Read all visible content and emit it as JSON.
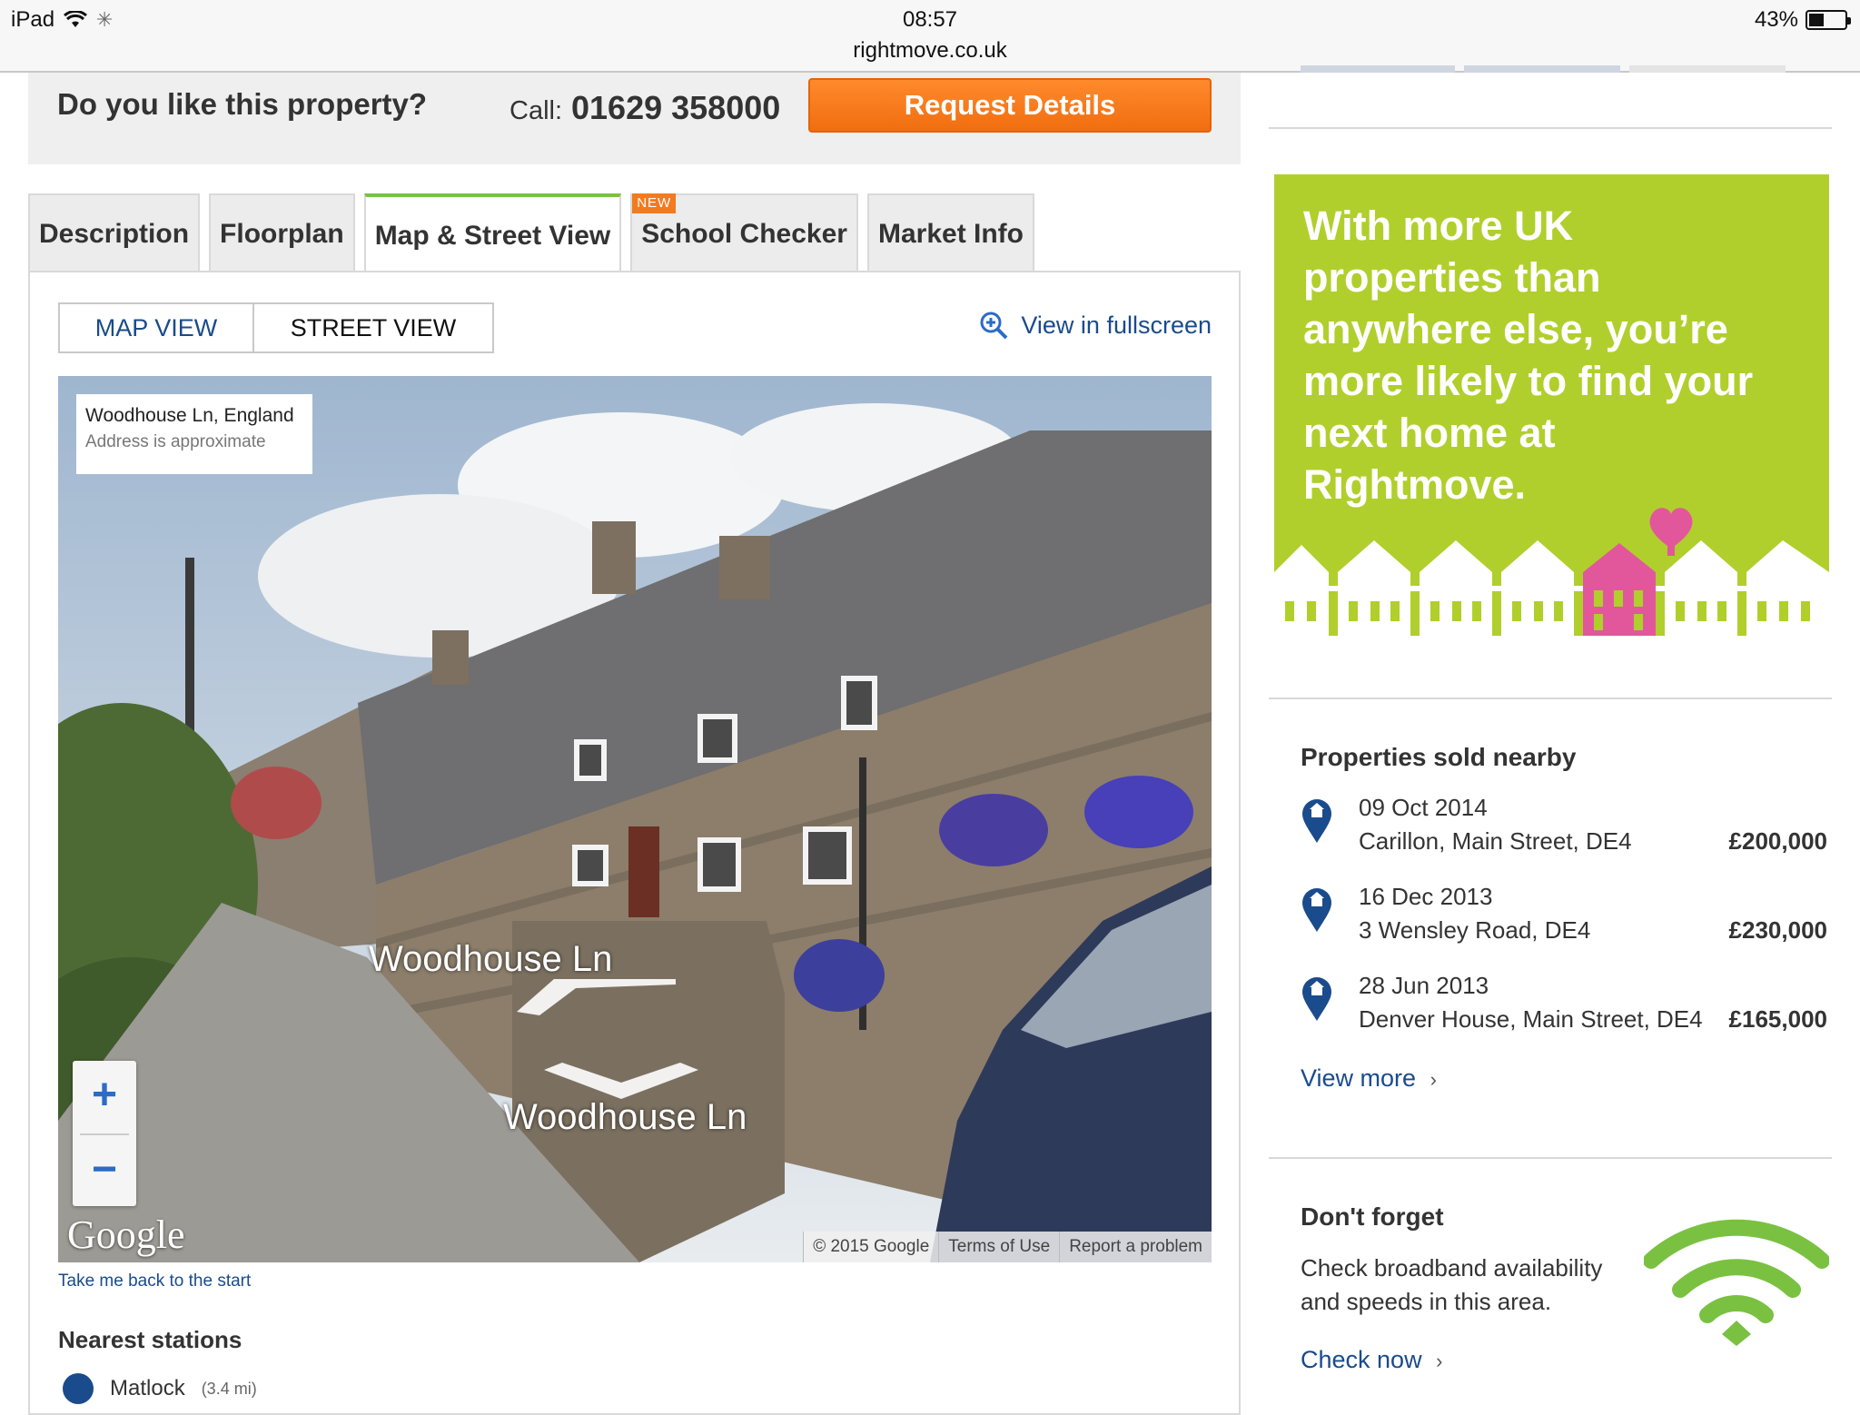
{
  "status_bar": {
    "device": "iPad",
    "time": "08:57",
    "url": "rightmove.co.uk",
    "battery": "43%",
    "battery_level": 0.43
  },
  "cta": {
    "question": "Do you like this property?",
    "call_label": "Call:",
    "phone": "01629 358000",
    "request_button": "Request Details"
  },
  "tabs": [
    {
      "label": "Description"
    },
    {
      "label": "Floorplan"
    },
    {
      "label": "Map & Street View",
      "active": true
    },
    {
      "label": "School Checker",
      "badge": "NEW"
    },
    {
      "label": "Market Info"
    }
  ],
  "map": {
    "map_view": "MAP VIEW",
    "street_view": "STREET VIEW",
    "fullscreen": "View in fullscreen",
    "address_line": "Woodhouse Ln, England",
    "address_note": "Address is approximate",
    "road_label_1": "Woodhouse Ln",
    "road_label_2": "Woodhouse Ln",
    "zoom_in": "+",
    "zoom_out": "−",
    "google_logo": "Google",
    "copyright": "© 2015 Google",
    "terms": "Terms of Use",
    "report": "Report a problem",
    "back_link": "Take me back to the start"
  },
  "stations": {
    "title": "Nearest stations",
    "items": [
      {
        "name": "Matlock",
        "distance": "(3.4 mi)"
      }
    ]
  },
  "ad": {
    "text": "With more UK properties than anywhere else, you’re more likely to find your next home at Rightmove.",
    "bg_color": "#b0cf2c",
    "accent_color": "#e2579c"
  },
  "sold_nearby": {
    "title": "Properties sold nearby",
    "items": [
      {
        "date": "09 Oct 2014",
        "address": "Carillon, Main Street, DE4",
        "price": "£200,000"
      },
      {
        "date": "16 Dec 2013",
        "address": "3 Wensley Road, DE4",
        "price": "£230,000"
      },
      {
        "date": "28 Jun 2013",
        "address": "Denver House, Main Street, DE4",
        "price": "£165,000"
      }
    ],
    "view_more": "View more"
  },
  "dont_forget": {
    "title": "Don't forget",
    "text": "Check broadband availability and speeds in this area.",
    "link": "Check now"
  },
  "colors": {
    "link_blue": "#1a4b8c",
    "cta_orange": "#f37a1f",
    "tab_active_green": "#7ac142",
    "wifi_green": "#7ac142"
  }
}
